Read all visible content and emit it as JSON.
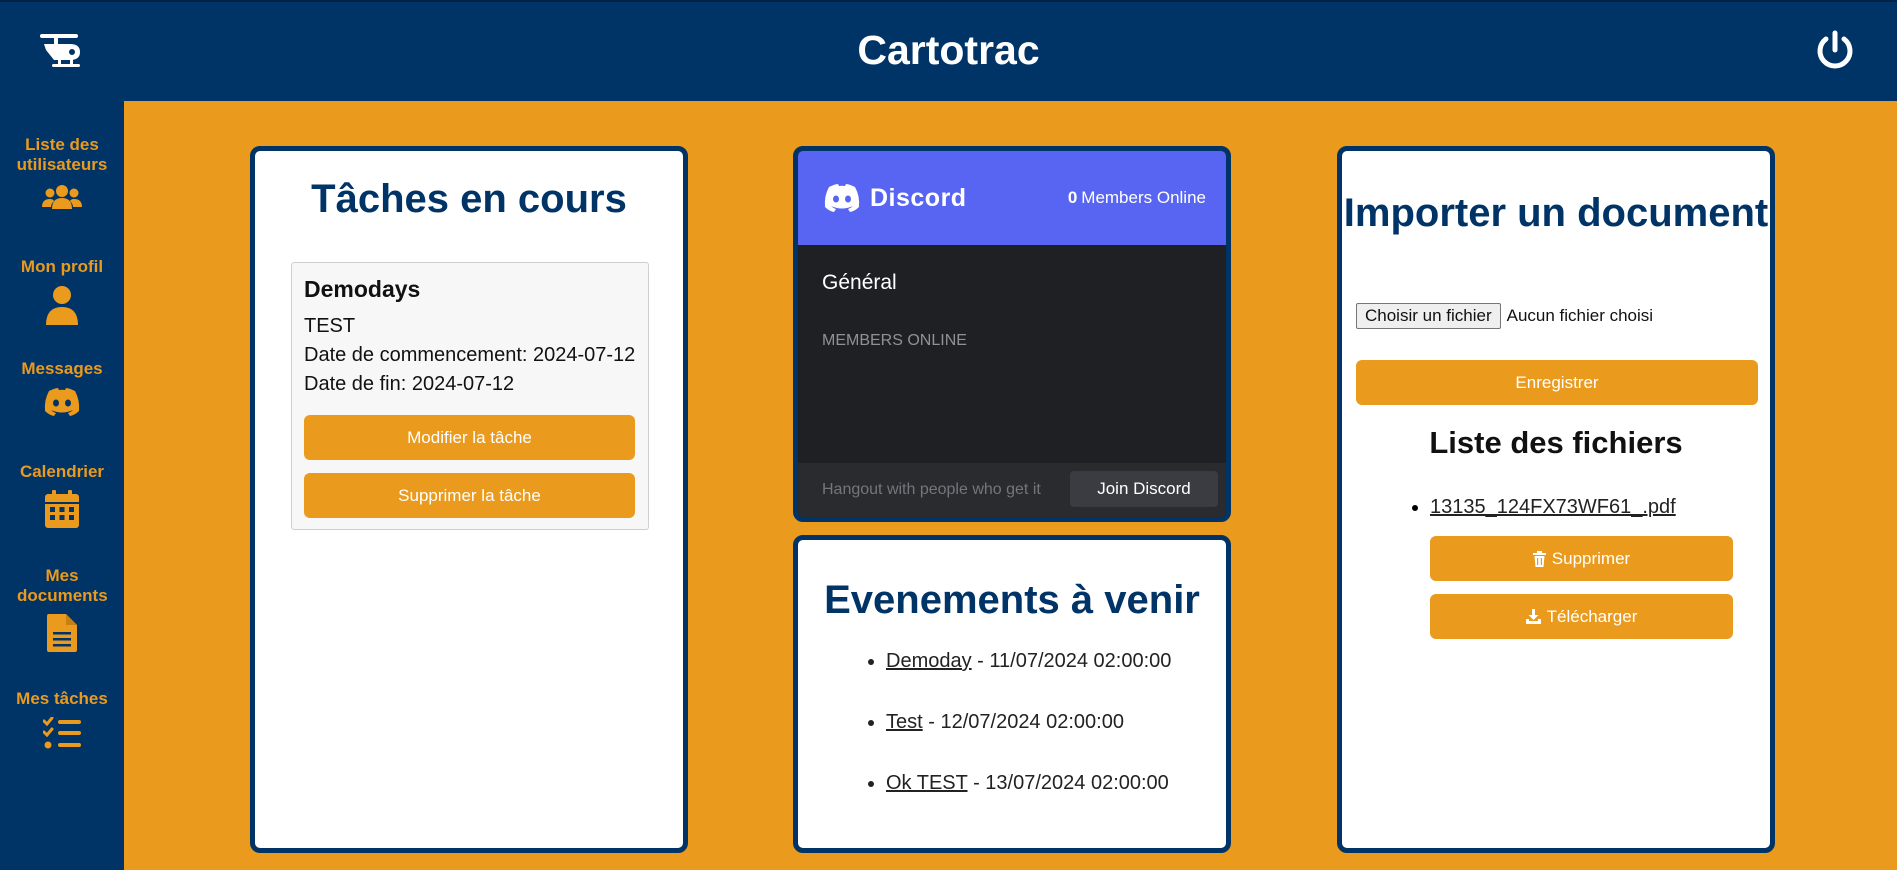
{
  "header": {
    "title": "Cartotrac"
  },
  "sidebar": {
    "items": [
      {
        "label": "Liste des utilisateurs",
        "icon": "users-icon"
      },
      {
        "label": "Mon profil",
        "icon": "user-icon"
      },
      {
        "label": "Messages",
        "icon": "discord-icon"
      },
      {
        "label": "Calendrier",
        "icon": "calendar-icon"
      },
      {
        "label": "Mes documents",
        "icon": "document-icon"
      },
      {
        "label": "Mes tâches",
        "icon": "task-list-icon"
      }
    ]
  },
  "tasks": {
    "title": "Tâches en cours",
    "task": {
      "name": "Demodays",
      "description": "TEST",
      "start": "Date de commencement: 2024-07-12",
      "end": "Date de fin: 2024-07-12",
      "edit_label": "Modifier la tâche",
      "delete_label": "Supprimer la tâche"
    }
  },
  "discord": {
    "brand": "Discord",
    "online_count": "0",
    "online_label": "Members Online",
    "channel": "Général",
    "members_heading": "MEMBERS ONLINE",
    "footer_text": "Hangout with people who get it",
    "join_label": "Join Discord"
  },
  "events": {
    "title": "Evenements à venir",
    "items": [
      {
        "name": "Demoday",
        "date": " - 11/07/2024 02:00:00"
      },
      {
        "name": "Test",
        "date": " - 12/07/2024 02:00:00"
      },
      {
        "name": "Ok TEST",
        "date": " - 13/07/2024 02:00:00"
      }
    ]
  },
  "documents": {
    "title": "Importer un document",
    "choose_label": "Choisir un fichier",
    "no_file_text": "Aucun fichier choisi",
    "save_label": "Enregistrer",
    "list_title": "Liste des fichiers",
    "files": [
      {
        "name": "13135_124FX73WF61_.pdf",
        "delete_label": "Supprimer",
        "download_label": "Télécharger"
      }
    ]
  },
  "colors": {
    "navy": "#003366",
    "orange": "#ea9a1c",
    "discord": "#5865f2"
  }
}
